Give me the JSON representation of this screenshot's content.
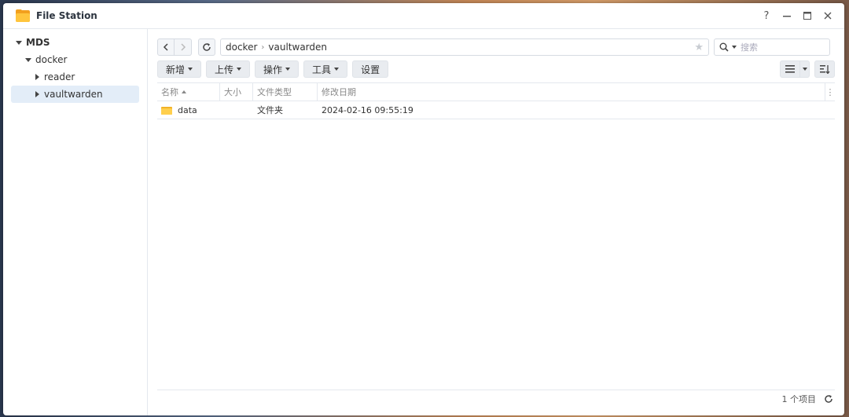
{
  "window": {
    "title": "File Station"
  },
  "window_controls": {
    "help": "?",
    "minimize": "—",
    "maximize": "☐",
    "close": "✕"
  },
  "sidebar": {
    "root": "MDS",
    "items": [
      {
        "label": "docker"
      },
      {
        "label": "reader"
      },
      {
        "label": "vaultwarden"
      }
    ]
  },
  "path": {
    "segments": [
      "docker",
      "vaultwarden"
    ],
    "separator": "›"
  },
  "search": {
    "placeholder": "搜索"
  },
  "toolbar": {
    "create": "新增",
    "upload": "上传",
    "action": "操作",
    "tools": "工具",
    "settings": "设置"
  },
  "table": {
    "headers": [
      "名称",
      "大小",
      "文件类型",
      "修改日期"
    ],
    "rows": [
      {
        "name": "data",
        "size": "",
        "type": "文件夹",
        "modified": "2024-02-16 09:55:19"
      }
    ]
  },
  "footer": {
    "count": "1 个项目"
  },
  "colors": {
    "accent": "#e3edf8",
    "folder": "#ffc53d"
  },
  "icons": [
    "folder-icon",
    "back-icon",
    "forward-icon",
    "refresh-icon",
    "star-icon",
    "search-icon",
    "list-view-icon",
    "sort-icon"
  ]
}
